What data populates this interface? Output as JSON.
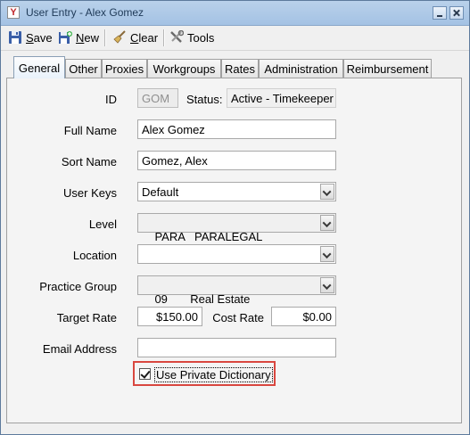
{
  "window": {
    "title": "User Entry - Alex Gomez",
    "app_icon_glyph": "Y"
  },
  "toolbar": {
    "save_prefix": "S",
    "save_rest": "ave",
    "new_prefix": "N",
    "new_rest": "ew",
    "clear_prefix": "C",
    "clear_rest": "lear",
    "tools_label": "Tools"
  },
  "tabs": [
    "General",
    "Other",
    "Proxies",
    "Workgroups",
    "Rates",
    "Administration",
    "Reimbursement"
  ],
  "active_tab": "General",
  "form": {
    "id_label": "ID",
    "id_value": "GOM",
    "status_label": "Status:",
    "status_value": "Active - Timekeeper",
    "full_name_label": "Full Name",
    "full_name_value": "Alex Gomez",
    "sort_name_label": "Sort Name",
    "sort_name_value": "Gomez, Alex",
    "user_keys_label": "User Keys",
    "user_keys_value": "Default",
    "level_label": "Level",
    "level_value": "PARA   PARALEGAL",
    "location_label": "Location",
    "location_value": "",
    "practice_group_label": "Practice Group",
    "practice_group_value": "09       Real Estate",
    "target_rate_label": "Target Rate",
    "target_rate_value": "$150.00",
    "cost_rate_label": "Cost Rate",
    "cost_rate_value": "$0.00",
    "email_label": "Email Address",
    "email_value": "",
    "private_dict_label": "Use Private Dictionary",
    "private_dict_checked": true
  }
}
